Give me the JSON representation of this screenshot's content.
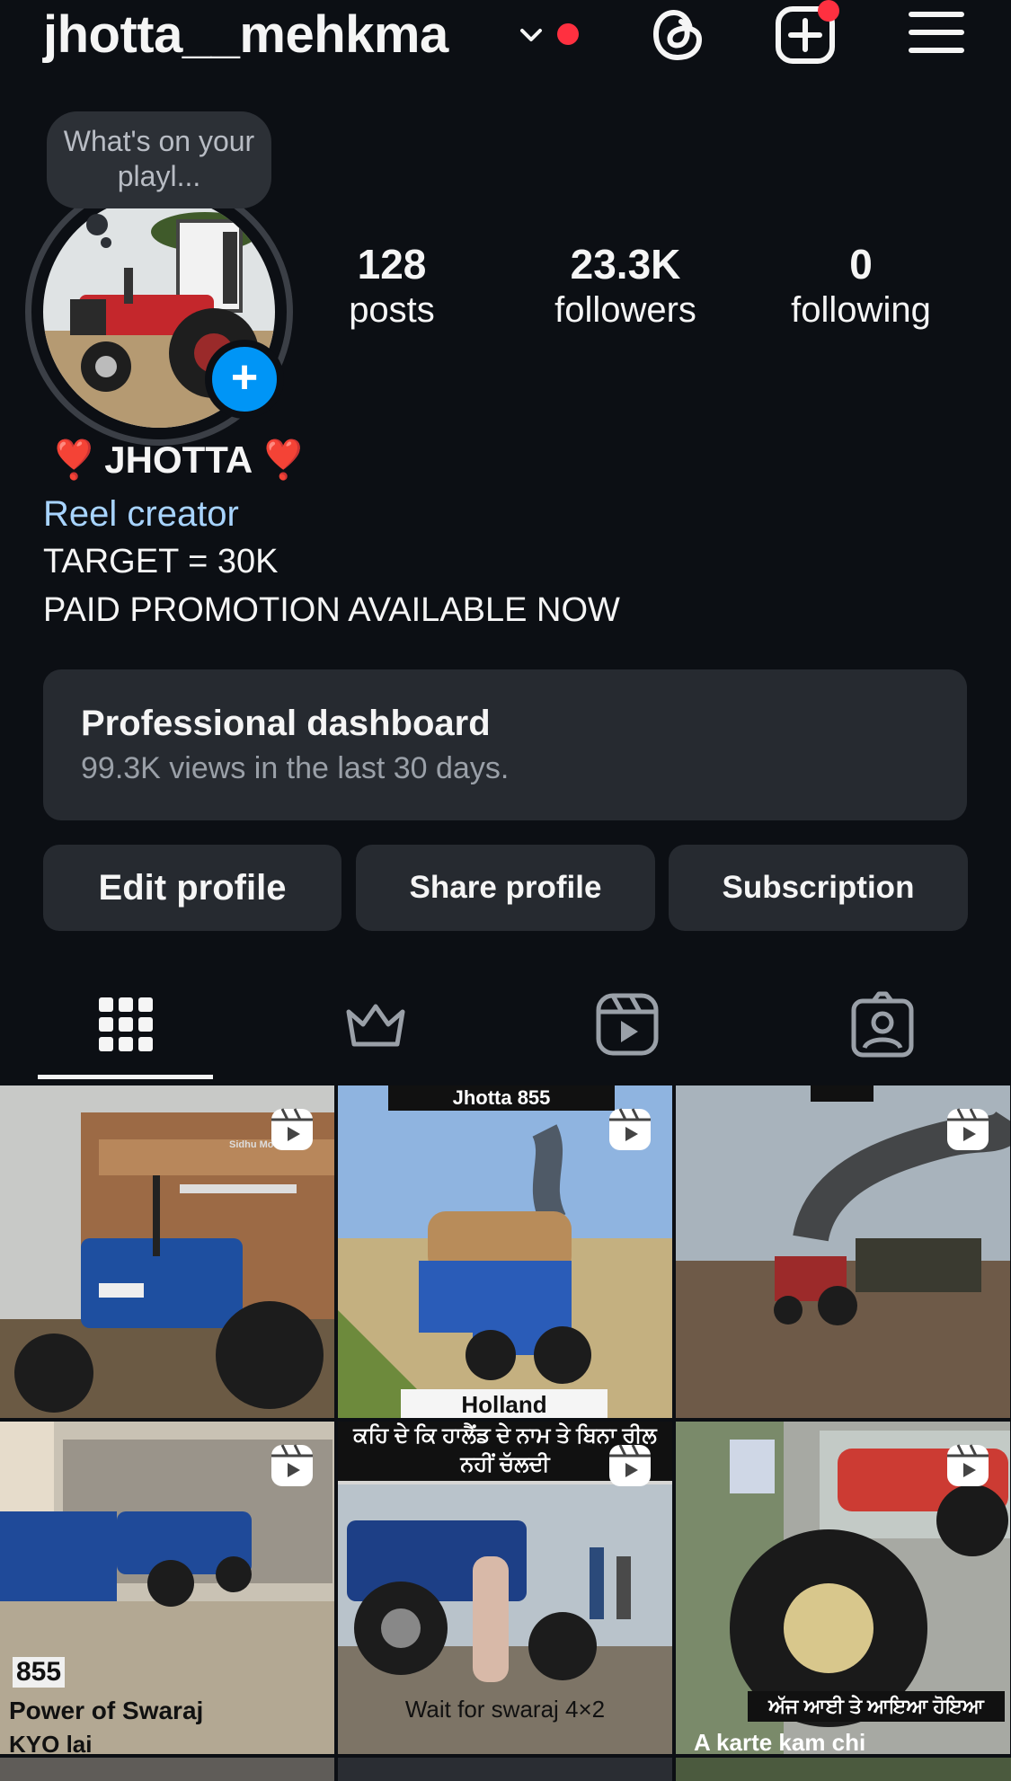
{
  "header": {
    "username": "jhotta__mehkma",
    "icons": [
      "chevron-down-icon",
      "threads-icon",
      "new-post-icon",
      "menu-icon"
    ],
    "notification_color": "#ff3040"
  },
  "profile": {
    "note": "What's on your playl...",
    "avatar_icon": "tractor-photo",
    "add_story_symbol": "+",
    "stats": [
      {
        "value": "128",
        "label": "posts"
      },
      {
        "value": "23.3K",
        "label": "followers"
      },
      {
        "value": "0",
        "label": "following"
      }
    ],
    "name": "JHOTTA",
    "name_emoji": "❣️",
    "category": "Reel creator",
    "bio_lines": [
      "TARGET = 30K",
      "PAID PROMOTION AVAILABLE NOW"
    ]
  },
  "dashboard": {
    "title": "Professional dashboard",
    "subtitle": "99.3K views in the last 30 days."
  },
  "buttons": {
    "edit": "Edit profile",
    "share": "Share profile",
    "subscription": "Subscription"
  },
  "tabs": [
    "grid-icon",
    "crown-icon",
    "reels-icon",
    "tagged-icon"
  ],
  "grid": {
    "captions": {
      "c1_watermark": "Sidhu Moose",
      "c2_top": "Jhotta 855",
      "c2_bottom": "Holland",
      "c4_line1": "855",
      "c4_line2": "Power of Swaraj",
      "c4_line3": "KYO lai",
      "c5_top": "ਕਹਿ ਦੇ ਕਿ ਹਾਲੈਂਡ ਦੇ ਨਾਮ ਤੇ ਬਿਨਾ ਰੀਲ ਨਹੀਂ ਚੱਲਦੀ",
      "c5_bottom": "Wait for swaraj 4×2",
      "c6_bottom": "ਅੱਜ ਆਈ ਤੇ ਆਇਆ ਹੋਇਆ",
      "c6_bottom2": "A karte kam chi"
    }
  },
  "colors": {
    "background": "#0c0f14",
    "surface": "#262a30",
    "accent_blue": "#0095f6",
    "link_blue": "#a8d4ff",
    "heart_red": "#e8262f"
  }
}
